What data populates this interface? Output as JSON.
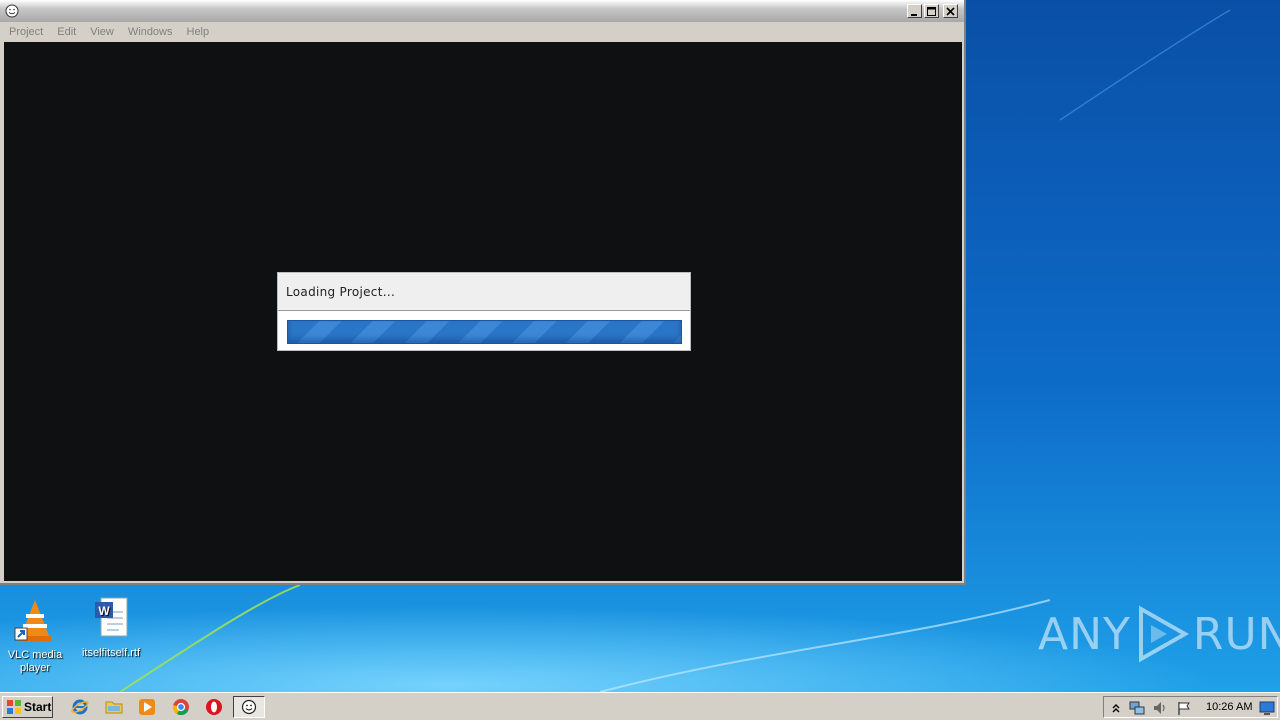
{
  "window": {
    "menu": [
      "Project",
      "Edit",
      "View",
      "Windows",
      "Help"
    ]
  },
  "dialog": {
    "title": "Loading Project...",
    "progress": 1.0
  },
  "desktop": {
    "icons": [
      {
        "label": "VLC media player",
        "icon": "vlc-icon"
      },
      {
        "label": "itselfitself.rtf",
        "icon": "word-document-icon"
      }
    ],
    "watermark": {
      "left": "ANY",
      "right": "RUN"
    }
  },
  "taskbar": {
    "start_label": "Start",
    "quick_launch": [
      "internet-explorer-icon",
      "folder-icon",
      "media-player-icon",
      "chrome-icon",
      "opera-icon"
    ],
    "active_app_icon": "smiley-app-icon",
    "tray_icons": [
      "show-hidden-icons-icon",
      "network-icon",
      "volume-icon",
      "action-center-flag-icon"
    ],
    "clock": "10:26 AM"
  },
  "colors": {
    "canvas": "#0e1012",
    "progress": "#2a76c6",
    "desktop": "#0b5fb3"
  }
}
